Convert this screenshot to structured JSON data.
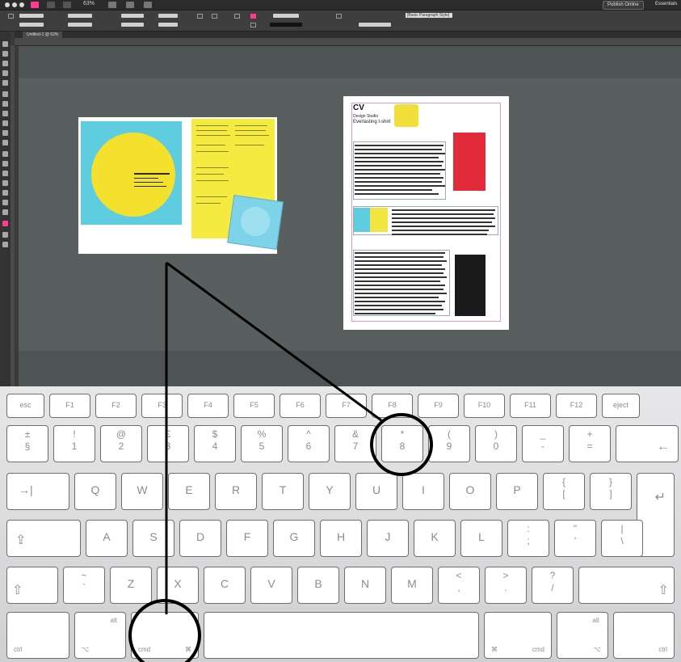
{
  "app": {
    "zoom": "63%",
    "publish_label": "Publish Online",
    "workspace_label": "Essentials",
    "doc_tab": "Untitled-1 @ 63%",
    "paragraph_style": "[Basic Paragraph Style]",
    "brand_color": "#ff3c8e"
  },
  "page": {
    "title": "CV",
    "subtitle": "Design Studio",
    "headline": "Everlasting t-shirt"
  },
  "keyboard": {
    "fn_row": [
      "esc",
      "F1",
      "F2",
      "F3",
      "F4",
      "F5",
      "F6",
      "F7",
      "F8",
      "F9",
      "F10",
      "F11",
      "F12",
      "eject"
    ],
    "number_row": [
      {
        "top": "±",
        "bottom": "§"
      },
      {
        "top": "!",
        "bottom": "1"
      },
      {
        "top": "@",
        "bottom": "2"
      },
      {
        "top": "£",
        "bottom": "3"
      },
      {
        "top": "$",
        "bottom": "4"
      },
      {
        "top": "%",
        "bottom": "5"
      },
      {
        "top": "^",
        "bottom": "6"
      },
      {
        "top": "&",
        "bottom": "7"
      },
      {
        "top": "*",
        "bottom": "8"
      },
      {
        "top": "(",
        "bottom": "9"
      },
      {
        "top": ")",
        "bottom": "0"
      },
      {
        "top": "_",
        "bottom": "-"
      },
      {
        "top": "+",
        "bottom": "="
      }
    ],
    "backspace": "←",
    "tab": "→|",
    "qwerty_row": [
      "Q",
      "W",
      "E",
      "R",
      "T",
      "Y",
      "U",
      "I",
      "O",
      "P"
    ],
    "qwerty_extra": [
      {
        "top": "{",
        "bottom": "["
      },
      {
        "top": "}",
        "bottom": "]"
      }
    ],
    "return": "↵",
    "caps": "⇪",
    "asdf_row": [
      "A",
      "S",
      "D",
      "F",
      "G",
      "H",
      "J",
      "K",
      "L"
    ],
    "asdf_extra": [
      {
        "top": ":",
        "bottom": ";"
      },
      {
        "top": "\"",
        "bottom": "'"
      },
      {
        "top": "|",
        "bottom": "\\"
      }
    ],
    "shift": "⇧",
    "zxcv_extra_left": {
      "top": "~",
      "bottom": "`"
    },
    "zxcv_row": [
      "Z",
      "X",
      "C",
      "V",
      "B",
      "N",
      "M"
    ],
    "zxcv_extra": [
      {
        "top": "<",
        "bottom": ","
      },
      {
        "top": ">",
        "bottom": "."
      },
      {
        "top": "?",
        "bottom": "/"
      }
    ],
    "ctrl": "ctrl",
    "alt": "alt",
    "opt_symbol": "⌥",
    "cmd": "cmd",
    "cmd_symbol": "⌘"
  }
}
